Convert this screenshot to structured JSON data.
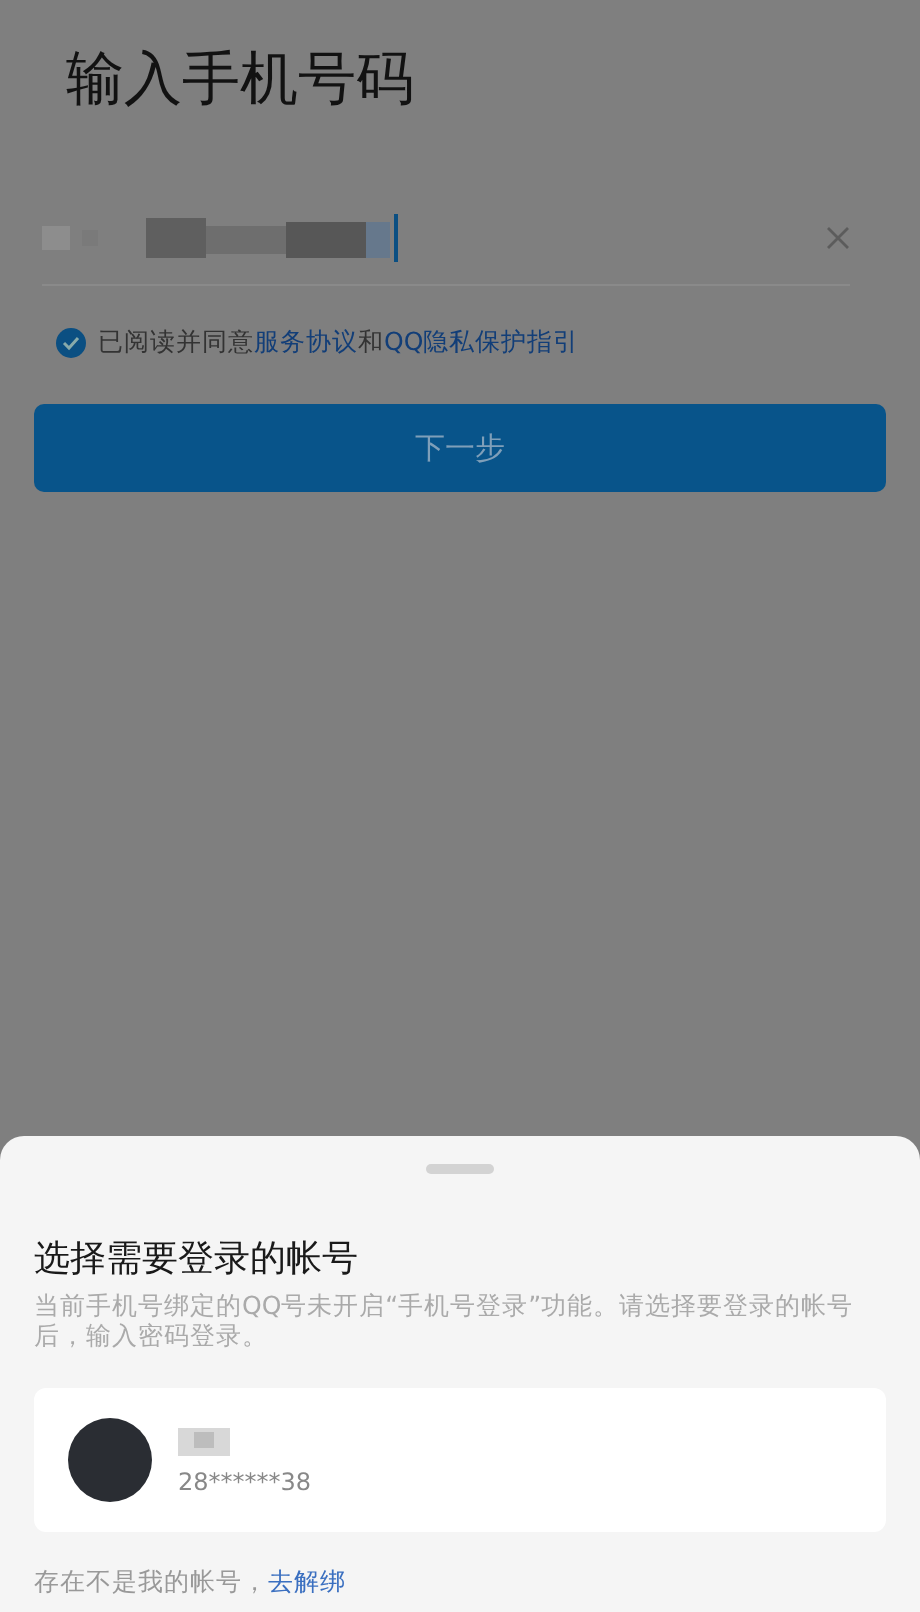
{
  "page_title": "输入手机号码",
  "agreement": {
    "checked": true,
    "prefix": "已阅读并同意",
    "links": [
      "服务协议",
      "QQ隐私保护指引"
    ],
    "joiner": "和"
  },
  "next_button": {
    "label": "下一步"
  },
  "account_sheet": {
    "title": "选择需要登录的帐号",
    "description": "当前手机号绑定的QQ号未开启“手机号登录”功能。请选择要登录的帐号后，输入密码登录。",
    "accounts": [
      {
        "number": "28******38"
      }
    ],
    "footer_text": "存在不是我的帐号，",
    "footer_link": "去解绑"
  }
}
